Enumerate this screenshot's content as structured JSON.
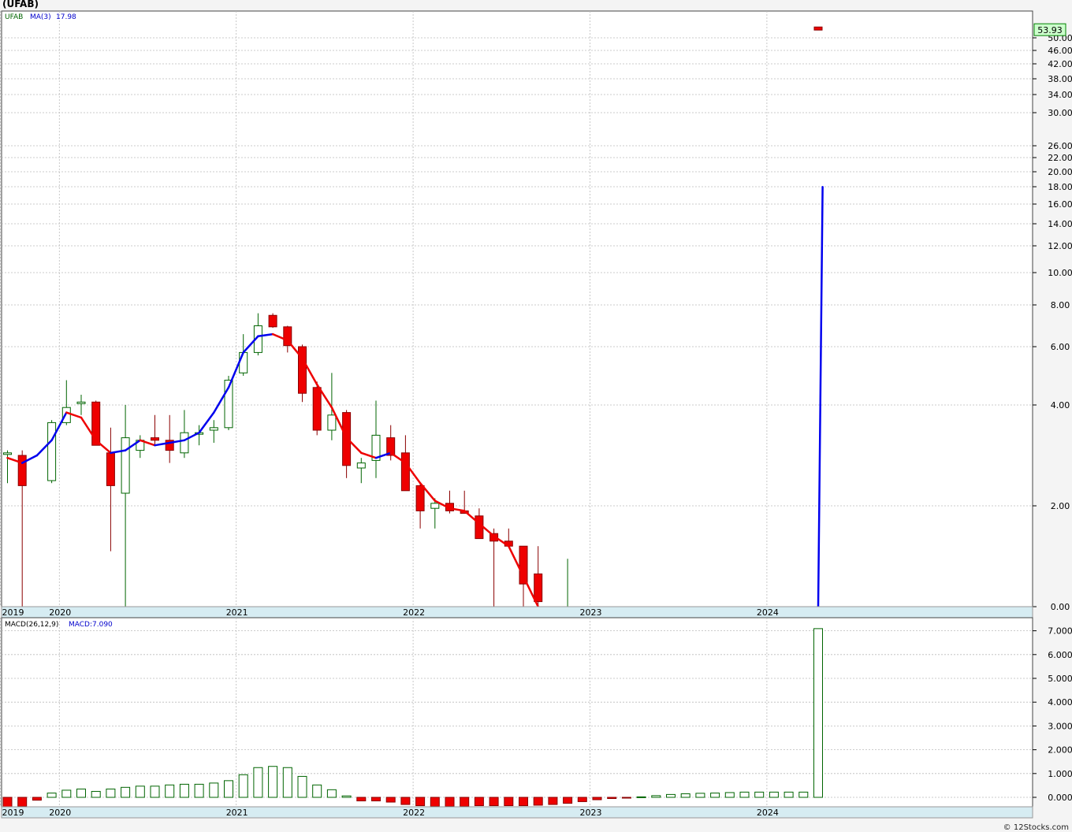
{
  "title": "(UFAB)",
  "footer": "© 12Stocks.com",
  "colors": {
    "up_body": "#ffffff",
    "up_stroke": "#006400",
    "down_body": "#ee0000",
    "down_stroke": "#8b0000",
    "ma_up": "#0000ee",
    "ma_down": "#ee0000",
    "grid": "#bbbbbb",
    "badge_bg": "#ccffcc",
    "badge_border": "#008000"
  },
  "chart_data": [
    {
      "type": "candlestick",
      "legend": {
        "symbol": "UFAB",
        "ma_label": "MA(3)",
        "ma_value": "17.98"
      },
      "last_price": "53.93",
      "x_labels": [
        {
          "label": "2019",
          "t": 0
        },
        {
          "label": "2020",
          "t": 4
        },
        {
          "label": "2021",
          "t": 16
        },
        {
          "label": "2022",
          "t": 28
        },
        {
          "label": "2023",
          "t": 40
        },
        {
          "label": "2024",
          "t": 52
        }
      ],
      "y_ticks": [
        "0.00",
        "2.00",
        "4.00",
        "6.00",
        "8.00",
        "10.00",
        "12.00",
        "14.00",
        "16.00",
        "18.00",
        "20.00",
        "22.00",
        "26.00",
        "30.00",
        "34.00",
        "38.00",
        "42.00",
        "46.00",
        "50.00"
      ],
      "candles": [
        {
          "t": 0,
          "o": 3.05,
          "h": 3.1,
          "l": 2.45,
          "c": 3.05
        },
        {
          "t": 1,
          "o": 3.0,
          "h": 3.1,
          "l": 0.0,
          "c": 2.4
        },
        {
          "t": 3,
          "o": 2.5,
          "h": 3.7,
          "l": 2.45,
          "c": 3.65
        },
        {
          "t": 4,
          "o": 3.65,
          "h": 4.85,
          "l": 3.6,
          "c": 3.95
        },
        {
          "t": 5,
          "o": 4.05,
          "h": 4.35,
          "l": 3.8,
          "c": 4.1
        },
        {
          "t": 6,
          "o": 4.1,
          "h": 4.15,
          "l": 3.2,
          "c": 3.2
        },
        {
          "t": 7,
          "o": 3.05,
          "h": 3.55,
          "l": 1.1,
          "c": 2.4
        },
        {
          "t": 8,
          "o": 2.25,
          "h": 4.0,
          "l": 0.0,
          "c": 3.35
        },
        {
          "t": 9,
          "o": 3.1,
          "h": 3.4,
          "l": 2.95,
          "c": 3.3
        },
        {
          "t": 10,
          "o": 3.35,
          "h": 3.8,
          "l": 3.2,
          "c": 3.3
        },
        {
          "t": 11,
          "o": 3.3,
          "h": 3.8,
          "l": 2.85,
          "c": 3.1
        },
        {
          "t": 12,
          "o": 3.05,
          "h": 3.9,
          "l": 2.95,
          "c": 3.45
        },
        {
          "t": 13,
          "o": 3.45,
          "h": 3.6,
          "l": 3.2,
          "c": 3.45
        },
        {
          "t": 14,
          "o": 3.5,
          "h": 3.7,
          "l": 3.25,
          "c": 3.55
        },
        {
          "t": 15,
          "o": 3.55,
          "h": 5.0,
          "l": 3.5,
          "c": 4.85
        },
        {
          "t": 16,
          "o": 5.1,
          "h": 6.6,
          "l": 5.0,
          "c": 5.8
        },
        {
          "t": 17,
          "o": 5.8,
          "h": 7.6,
          "l": 5.7,
          "c": 7.0
        },
        {
          "t": 18,
          "o": 7.5,
          "h": 7.6,
          "l": 6.9,
          "c": 6.95
        },
        {
          "t": 19,
          "o": 6.95,
          "h": 7.0,
          "l": 5.8,
          "c": 6.05
        },
        {
          "t": 20,
          "o": 6.0,
          "h": 6.1,
          "l": 4.1,
          "c": 4.4
        },
        {
          "t": 21,
          "o": 4.6,
          "h": 4.8,
          "l": 3.4,
          "c": 3.5
        },
        {
          "t": 22,
          "o": 3.5,
          "h": 5.1,
          "l": 3.3,
          "c": 3.8
        },
        {
          "t": 23,
          "o": 3.85,
          "h": 3.9,
          "l": 2.55,
          "c": 2.8
        },
        {
          "t": 24,
          "o": 2.75,
          "h": 2.95,
          "l": 2.45,
          "c": 2.85
        },
        {
          "t": 25,
          "o": 2.9,
          "h": 4.15,
          "l": 2.55,
          "c": 3.4
        },
        {
          "t": 26,
          "o": 3.35,
          "h": 3.6,
          "l": 2.9,
          "c": 3.0
        },
        {
          "t": 27,
          "o": 3.05,
          "h": 3.4,
          "l": 2.3,
          "c": 2.3
        },
        {
          "t": 28,
          "o": 2.4,
          "h": 2.45,
          "l": 1.55,
          "c": 1.9
        },
        {
          "t": 29,
          "o": 1.95,
          "h": 2.15,
          "l": 1.55,
          "c": 2.05
        },
        {
          "t": 30,
          "o": 2.05,
          "h": 2.3,
          "l": 1.85,
          "c": 1.9
        },
        {
          "t": 31,
          "o": 1.9,
          "h": 2.3,
          "l": 1.85,
          "c": 1.85
        },
        {
          "t": 32,
          "o": 1.8,
          "h": 1.95,
          "l": 1.35,
          "c": 1.35
        },
        {
          "t": 33,
          "o": 1.45,
          "h": 1.55,
          "l": 0.0,
          "c": 1.3
        },
        {
          "t": 34,
          "o": 1.3,
          "h": 1.55,
          "l": 1.2,
          "c": 1.2
        },
        {
          "t": 35,
          "o": 1.2,
          "h": 1.2,
          "l": 0.0,
          "c": 0.45
        },
        {
          "t": 36,
          "o": 0.65,
          "h": 1.2,
          "l": 0.0,
          "c": 0.1
        },
        {
          "t": 38,
          "o": 0.0,
          "h": 0.95,
          "l": 0.0,
          "c": 0.0
        },
        {
          "t": 55,
          "o": 55.5,
          "h": 55.5,
          "l": 53.9,
          "c": 53.93
        }
      ],
      "ma": [
        {
          "t": 0,
          "v": 2.95
        },
        {
          "t": 1,
          "v": 2.85
        },
        {
          "t": 2,
          "v": 3.0
        },
        {
          "t": 3,
          "v": 3.3
        },
        {
          "t": 4,
          "v": 3.85
        },
        {
          "t": 5,
          "v": 3.75
        },
        {
          "t": 6,
          "v": 3.3
        },
        {
          "t": 7,
          "v": 3.05
        },
        {
          "t": 8,
          "v": 3.1
        },
        {
          "t": 9,
          "v": 3.3
        },
        {
          "t": 10,
          "v": 3.2
        },
        {
          "t": 11,
          "v": 3.25
        },
        {
          "t": 12,
          "v": 3.3
        },
        {
          "t": 13,
          "v": 3.45
        },
        {
          "t": 14,
          "v": 3.85
        },
        {
          "t": 15,
          "v": 4.6
        },
        {
          "t": 16,
          "v": 5.8
        },
        {
          "t": 17,
          "v": 6.5
        },
        {
          "t": 18,
          "v": 6.6
        },
        {
          "t": 19,
          "v": 6.3
        },
        {
          "t": 20,
          "v": 5.6
        },
        {
          "t": 21,
          "v": 4.7
        },
        {
          "t": 22,
          "v": 3.95
        },
        {
          "t": 23,
          "v": 3.35
        },
        {
          "t": 24,
          "v": 3.05
        },
        {
          "t": 25,
          "v": 2.95
        },
        {
          "t": 26,
          "v": 3.05
        },
        {
          "t": 27,
          "v": 2.85
        },
        {
          "t": 28,
          "v": 2.45
        },
        {
          "t": 29,
          "v": 2.1
        },
        {
          "t": 30,
          "v": 1.95
        },
        {
          "t": 31,
          "v": 1.9
        },
        {
          "t": 32,
          "v": 1.65
        },
        {
          "t": 33,
          "v": 1.4
        },
        {
          "t": 34,
          "v": 1.2
        },
        {
          "t": 35,
          "v": 0.6
        },
        {
          "t": 36,
          "v": 0.0
        },
        {
          "t": 55,
          "v": 0.0
        },
        {
          "t": 55.3,
          "v": 17.98
        }
      ]
    },
    {
      "type": "bar",
      "legend": {
        "label": "MACD(26,12,9)",
        "macd_label": "MACD:7.090"
      },
      "y_ticks": [
        "0.000",
        "1.000",
        "2.000",
        "3.000",
        "4.000",
        "5.000",
        "6.000",
        "7.000"
      ],
      "bars": [
        {
          "t": 0,
          "v": -0.42
        },
        {
          "t": 1,
          "v": -0.38
        },
        {
          "t": 2,
          "v": -0.12
        },
        {
          "t": 3,
          "v": 0.18
        },
        {
          "t": 4,
          "v": 0.3
        },
        {
          "t": 5,
          "v": 0.35
        },
        {
          "t": 6,
          "v": 0.25
        },
        {
          "t": 7,
          "v": 0.35
        },
        {
          "t": 8,
          "v": 0.42
        },
        {
          "t": 9,
          "v": 0.47
        },
        {
          "t": 10,
          "v": 0.47
        },
        {
          "t": 11,
          "v": 0.52
        },
        {
          "t": 12,
          "v": 0.55
        },
        {
          "t": 13,
          "v": 0.55
        },
        {
          "t": 14,
          "v": 0.6
        },
        {
          "t": 15,
          "v": 0.7
        },
        {
          "t": 16,
          "v": 0.95
        },
        {
          "t": 17,
          "v": 1.25
        },
        {
          "t": 18,
          "v": 1.3
        },
        {
          "t": 19,
          "v": 1.25
        },
        {
          "t": 20,
          "v": 0.88
        },
        {
          "t": 21,
          "v": 0.52
        },
        {
          "t": 22,
          "v": 0.32
        },
        {
          "t": 23,
          "v": 0.06
        },
        {
          "t": 24,
          "v": -0.15
        },
        {
          "t": 25,
          "v": -0.15
        },
        {
          "t": 26,
          "v": -0.2
        },
        {
          "t": 27,
          "v": -0.3
        },
        {
          "t": 28,
          "v": -0.35
        },
        {
          "t": 29,
          "v": -0.38
        },
        {
          "t": 30,
          "v": -0.38
        },
        {
          "t": 31,
          "v": -0.38
        },
        {
          "t": 32,
          "v": -0.35
        },
        {
          "t": 33,
          "v": -0.35
        },
        {
          "t": 34,
          "v": -0.35
        },
        {
          "t": 35,
          "v": -0.35
        },
        {
          "t": 36,
          "v": -0.33
        },
        {
          "t": 37,
          "v": -0.3
        },
        {
          "t": 38,
          "v": -0.25
        },
        {
          "t": 39,
          "v": -0.18
        },
        {
          "t": 40,
          "v": -0.1
        },
        {
          "t": 41,
          "v": -0.05
        },
        {
          "t": 42,
          "v": -0.03
        },
        {
          "t": 43,
          "v": 0.02
        },
        {
          "t": 44,
          "v": 0.07
        },
        {
          "t": 45,
          "v": 0.12
        },
        {
          "t": 46,
          "v": 0.15
        },
        {
          "t": 47,
          "v": 0.17
        },
        {
          "t": 48,
          "v": 0.18
        },
        {
          "t": 49,
          "v": 0.2
        },
        {
          "t": 50,
          "v": 0.22
        },
        {
          "t": 51,
          "v": 0.22
        },
        {
          "t": 52,
          "v": 0.22
        },
        {
          "t": 53,
          "v": 0.22
        },
        {
          "t": 54,
          "v": 0.22
        },
        {
          "t": 55,
          "v": 7.09
        }
      ]
    }
  ]
}
